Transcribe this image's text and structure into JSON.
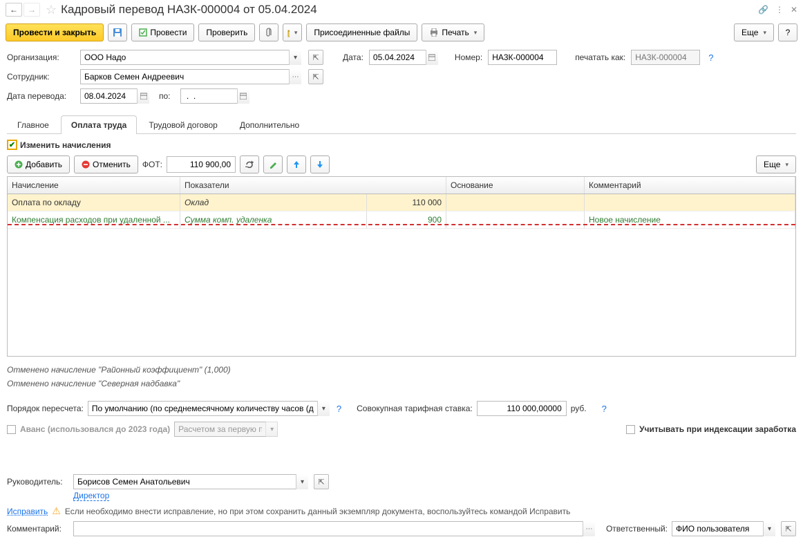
{
  "title": "Кадровый перевод НА3К-000004 от 05.04.2024",
  "toolbar": {
    "post_close": "Провести и закрыть",
    "post": "Провести",
    "check": "Проверить",
    "attached_files": "Присоединенные файлы",
    "print": "Печать",
    "more": "Еще",
    "help": "?"
  },
  "form": {
    "org_label": "Организация:",
    "org_value": "ООО Надо",
    "date_label": "Дата:",
    "date_value": "05.04.2024",
    "number_label": "Номер:",
    "number_value": "НА3К-000004",
    "print_as_label": "печатать как:",
    "print_as_placeholder": "НА3К-000004",
    "employee_label": "Сотрудник:",
    "employee_value": "Барков Семен Андреевич",
    "transfer_date_label": "Дата перевода:",
    "transfer_date_value": "08.04.2024",
    "to_label": "по:",
    "to_value": " .  .    "
  },
  "tabs": {
    "main": "Главное",
    "payroll": "Оплата труда",
    "contract": "Трудовой договор",
    "additional": "Дополнительно"
  },
  "payroll": {
    "change_accruals": "Изменить начисления",
    "add": "Добавить",
    "cancel": "Отменить",
    "fot_label": "ФОТ:",
    "fot_value": "110 900,00",
    "more": "Еще",
    "grid": {
      "h1": "Начисление",
      "h2": "Показатели",
      "h3": "Основание",
      "h4": "Комментарий",
      "r1_name": "Оплата по окладу",
      "r1_indicator": "Оклад",
      "r1_value": "110 000",
      "r2_name": "Компенсация расходов при удаленной ...",
      "r2_indicator": "Сумма комп. удаленка",
      "r2_value": "900",
      "r2_comment": "Новое начисление"
    },
    "cancelled1": "Отменено начисление \"Районный коэффициент\" (1,000)",
    "cancelled2": "Отменено начисление \"Северная надбавка\"",
    "recalc_order_label": "Порядок пересчета:",
    "recalc_order_value": "По умолчанию (по среднемесячному количеству часов (дней",
    "aggregate_rate_label": "Совокупная тарифная ставка:",
    "aggregate_rate_value": "110 000,00000",
    "aggregate_rate_unit": "руб.",
    "advance_label": "Аванс (использовался до 2023 года)",
    "advance_value": "Расчетом за первую пол",
    "indexation_label": "Учитывать при индексации заработка"
  },
  "lower": {
    "manager_label": "Руководитель:",
    "manager_value": "Борисов Семен Анатольевич",
    "manager_position": "Директор",
    "correct_link": "Исправить",
    "correct_text": "Если необходимо внести исправление, но при этом сохранить данный экземпляр документа, воспользуйтесь командой Исправить"
  },
  "footer": {
    "comment_label": "Комментарий:",
    "responsible_label": "Ответственный:",
    "responsible_value": "ФИО пользователя"
  }
}
